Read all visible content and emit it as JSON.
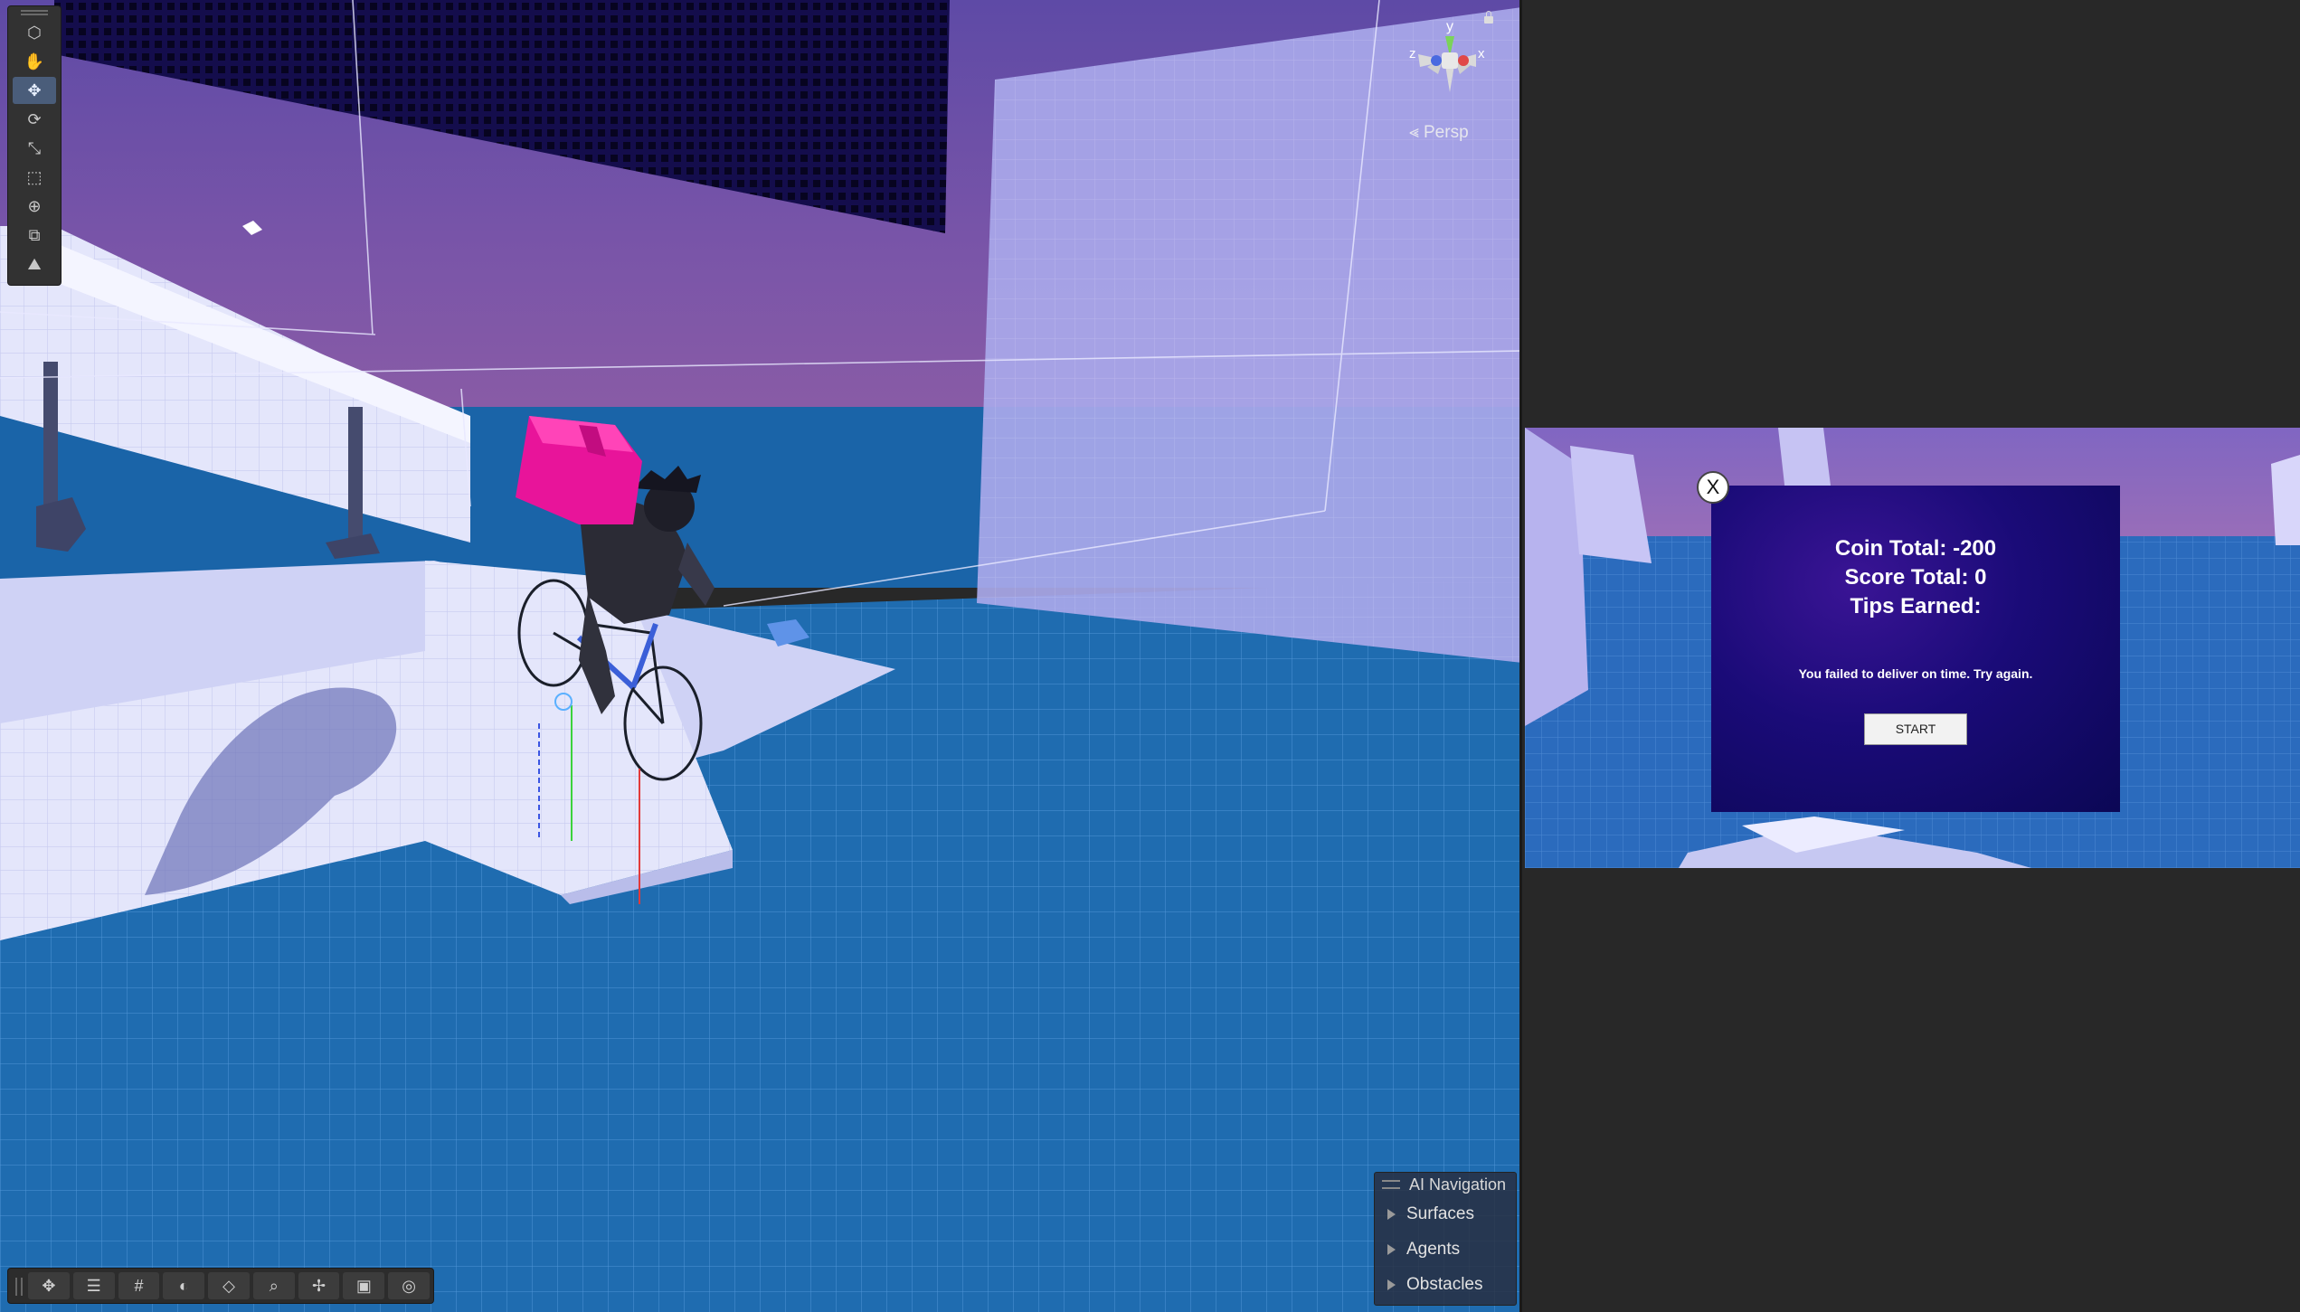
{
  "scene": {
    "tools": [
      {
        "icon": "view-cube-icon",
        "glyph": "⬡",
        "active": false
      },
      {
        "icon": "hand-tool-icon",
        "glyph": "✋",
        "active": false
      },
      {
        "icon": "move-tool-icon",
        "glyph": "✥",
        "active": true
      },
      {
        "icon": "rotate-tool-icon",
        "glyph": "⟳",
        "active": false
      },
      {
        "icon": "scale-tool-icon",
        "glyph": "⤡",
        "active": false
      },
      {
        "icon": "rect-tool-icon",
        "glyph": "⬚",
        "active": false
      },
      {
        "icon": "transform-tool-icon",
        "glyph": "⊕",
        "active": false
      },
      {
        "icon": "custom-tool-icon",
        "glyph": "⧉",
        "active": false
      },
      {
        "icon": "terrain-tool-icon",
        "glyph": "⛰",
        "active": false
      }
    ],
    "gizmo": {
      "y_label": "y",
      "x_label": "x",
      "z_label": "z"
    },
    "projection_label": "Persp",
    "bottom_toolbar": [
      {
        "icon": "move-overlay-icon",
        "glyph": "✥"
      },
      {
        "icon": "sliders-icon",
        "glyph": "☰"
      },
      {
        "icon": "grid-icon",
        "glyph": "#"
      },
      {
        "icon": "shading-icon",
        "glyph": "◐"
      },
      {
        "icon": "layers-icon",
        "glyph": "◇"
      },
      {
        "icon": "search-icon",
        "glyph": "⌕"
      },
      {
        "icon": "pivot-icon",
        "glyph": "✢"
      },
      {
        "icon": "camera-icon",
        "glyph": "▣"
      },
      {
        "icon": "compass-icon",
        "glyph": "◎"
      }
    ],
    "ai_navigation": {
      "title": "AI Navigation",
      "items": [
        "Surfaces",
        "Agents",
        "Obstacles"
      ]
    }
  },
  "game": {
    "close_label": "X",
    "coin_total": "Coin Total: -200",
    "score_total": "Score Total: 0",
    "tips_earned": "Tips Earned:",
    "message": "You failed to deliver on time. Try again.",
    "start_label": "START"
  }
}
